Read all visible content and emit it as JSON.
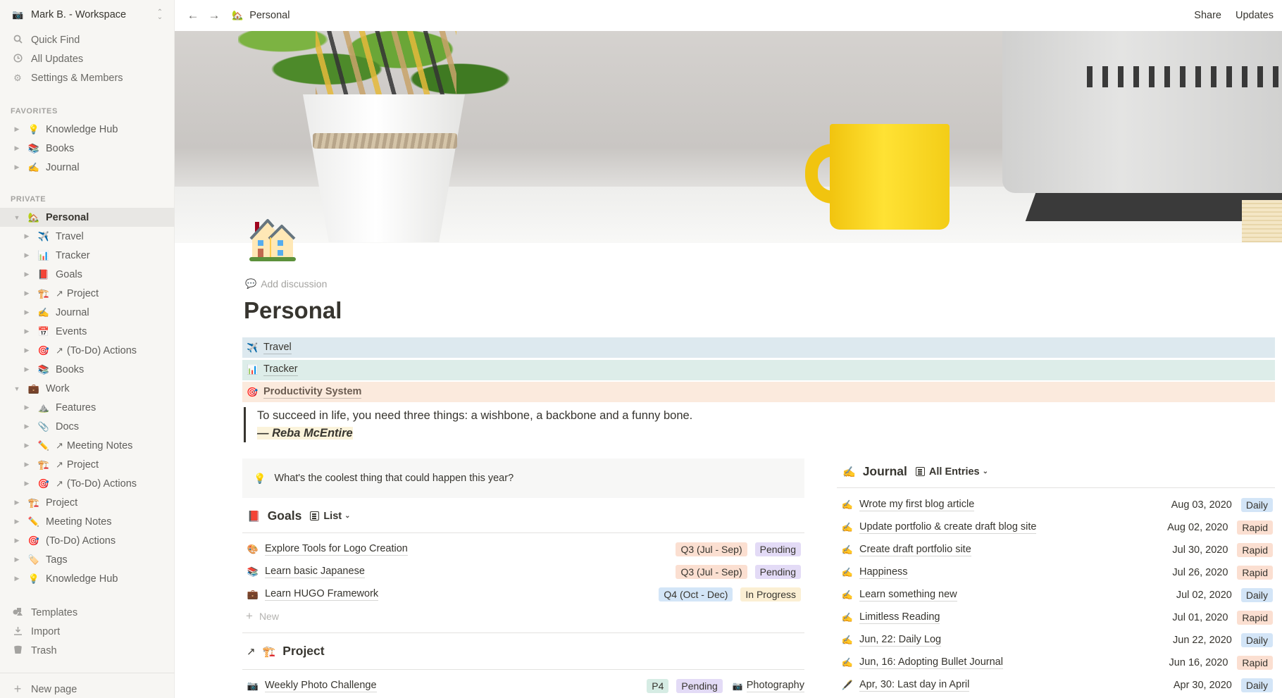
{
  "sidebar": {
    "workspace": {
      "icon": "camera-icon",
      "name": "Mark B. - Workspace"
    },
    "nav": [
      {
        "label": "Quick Find",
        "icon": "search-icon"
      },
      {
        "label": "All Updates",
        "icon": "clock-icon"
      },
      {
        "label": "Settings & Members",
        "icon": "gear-icon"
      }
    ],
    "favorites_label": "FAVORITES",
    "favorites": [
      {
        "label": "Knowledge Hub",
        "emoji": "💡"
      },
      {
        "label": "Books",
        "emoji": "📚"
      },
      {
        "label": "Journal",
        "emoji": "✍️"
      }
    ],
    "private_label": "PRIVATE",
    "private": [
      {
        "label": "Personal",
        "emoji": "🏡",
        "level": 0,
        "expanded": true,
        "active": true
      },
      {
        "label": "Travel",
        "emoji": "✈️",
        "level": 1
      },
      {
        "label": "Tracker",
        "emoji": "📊",
        "level": 1
      },
      {
        "label": "Goals",
        "emoji": "📕",
        "level": 1
      },
      {
        "label": "Project",
        "emoji": "🏗️",
        "level": 1,
        "linked": true
      },
      {
        "label": "Journal",
        "emoji": "✍️",
        "level": 1
      },
      {
        "label": "Events",
        "emoji": "📅",
        "level": 1
      },
      {
        "label": "(To-Do) Actions",
        "emoji": "🎯",
        "level": 1,
        "linked": true
      },
      {
        "label": "Books",
        "emoji": "📚",
        "level": 1
      },
      {
        "label": "Work",
        "emoji": "💼",
        "level": 0,
        "expanded": true
      },
      {
        "label": "Features",
        "emoji": "⛰️",
        "level": 1
      },
      {
        "label": "Docs",
        "emoji": "📎",
        "level": 1
      },
      {
        "label": "Meeting Notes",
        "emoji": "✏️",
        "level": 1,
        "linked": true
      },
      {
        "label": "Project",
        "emoji": "🏗️",
        "level": 1,
        "linked": true
      },
      {
        "label": "(To-Do) Actions",
        "emoji": "🎯",
        "level": 1,
        "linked": true
      },
      {
        "label": "Project",
        "emoji": "🏗️",
        "level": 0
      },
      {
        "label": "Meeting Notes",
        "emoji": "✏️",
        "level": 0
      },
      {
        "label": "(To-Do) Actions",
        "emoji": "🎯",
        "level": 0
      },
      {
        "label": "Tags",
        "emoji": "🏷️",
        "level": 0
      },
      {
        "label": "Knowledge Hub",
        "emoji": "💡",
        "level": 0
      }
    ],
    "bottom": [
      {
        "label": "Templates",
        "icon": "templates-icon"
      },
      {
        "label": "Import",
        "icon": "import-icon"
      },
      {
        "label": "Trash",
        "icon": "trash-icon"
      }
    ],
    "new_page": "New page"
  },
  "topbar": {
    "breadcrumb": {
      "emoji": "🏡",
      "label": "Personal"
    },
    "share": "Share",
    "updates": "Updates"
  },
  "page": {
    "icon": "house-icon",
    "add_discussion": "Add discussion",
    "title": "Personal",
    "links": [
      {
        "emoji": "✈️",
        "label": "Travel",
        "color": "#dde9ef"
      },
      {
        "emoji": "📊",
        "label": "Tracker",
        "color": "#ddede9"
      },
      {
        "emoji": "🎯",
        "label": "Productivity System",
        "color": "#fbeadd"
      }
    ],
    "quote": {
      "text": "To succeed in life, you need three things: a wishbone, a backbone and a funny bone.",
      "author": "— Reba McEntire"
    },
    "prompt": {
      "emoji": "💡",
      "text": "What's the coolest thing that could happen this year?"
    }
  },
  "goals": {
    "emoji": "📕",
    "title": "Goals",
    "view": "List",
    "rows": [
      {
        "emoji": "🎨",
        "title": "Explore Tools for Logo Creation",
        "quarter": "Q3 (Jul - Sep)",
        "quarter_color": "#fbdfd1",
        "status": "Pending",
        "status_color": "#e3dbf6"
      },
      {
        "emoji": "📚",
        "title": "Learn basic Japanese",
        "quarter": "Q3 (Jul - Sep)",
        "quarter_color": "#fbdfd1",
        "status": "Pending",
        "status_color": "#e3dbf6"
      },
      {
        "emoji": "💼",
        "title": "Learn HUGO Framework",
        "quarter": "Q4 (Oct - Dec)",
        "quarter_color": "#d3e5f7",
        "status": "In Progress",
        "status_color": "#fbefd3"
      }
    ],
    "new_label": "New"
  },
  "project": {
    "arrow": "↗",
    "emoji": "🏗️",
    "title": "Project",
    "rows": [
      {
        "emoji": "📷",
        "title": "Weekly Photo Challenge",
        "priority": "P4",
        "priority_color": "#d6ece4",
        "status": "Pending",
        "status_color": "#e3dbf6",
        "relation_emoji": "📷",
        "relation": "Photography"
      }
    ]
  },
  "journal": {
    "emoji": "✍️",
    "title": "Journal",
    "view": "All Entries",
    "rows": [
      {
        "emoji": "✍️",
        "title": "Wrote my first blog article",
        "date": "Aug 03, 2020",
        "type": "Daily",
        "type_color": "#d3e5f7"
      },
      {
        "emoji": "✍️",
        "title": "Update portfolio & create draft blog site",
        "date": "Aug 02, 2020",
        "type": "Rapid",
        "type_color": "#fbdfd1"
      },
      {
        "emoji": "✍️",
        "title": "Create draft portfolio site",
        "date": "Jul 30, 2020",
        "type": "Rapid",
        "type_color": "#fbdfd1"
      },
      {
        "emoji": "✍️",
        "title": "Happiness",
        "date": "Jul 26, 2020",
        "type": "Rapid",
        "type_color": "#fbdfd1"
      },
      {
        "emoji": "✍️",
        "title": "Learn something new",
        "date": "Jul 02, 2020",
        "type": "Daily",
        "type_color": "#d3e5f7"
      },
      {
        "emoji": "✍️",
        "title": "Limitless Reading",
        "date": "Jul 01, 2020",
        "type": "Rapid",
        "type_color": "#fbdfd1"
      },
      {
        "emoji": "✍️",
        "title": "Jun, 22: Daily Log",
        "date": "Jun 22, 2020",
        "type": "Daily",
        "type_color": "#d3e5f7"
      },
      {
        "emoji": "✍️",
        "title": "Jun, 16: Adopting Bullet Journal",
        "date": "Jun 16, 2020",
        "type": "Rapid",
        "type_color": "#fbdfd1"
      },
      {
        "emoji": "🖋️",
        "title": "Apr, 30: Last day in April",
        "date": "Apr 30, 2020",
        "type": "Daily",
        "type_color": "#d3e5f7"
      }
    ]
  }
}
